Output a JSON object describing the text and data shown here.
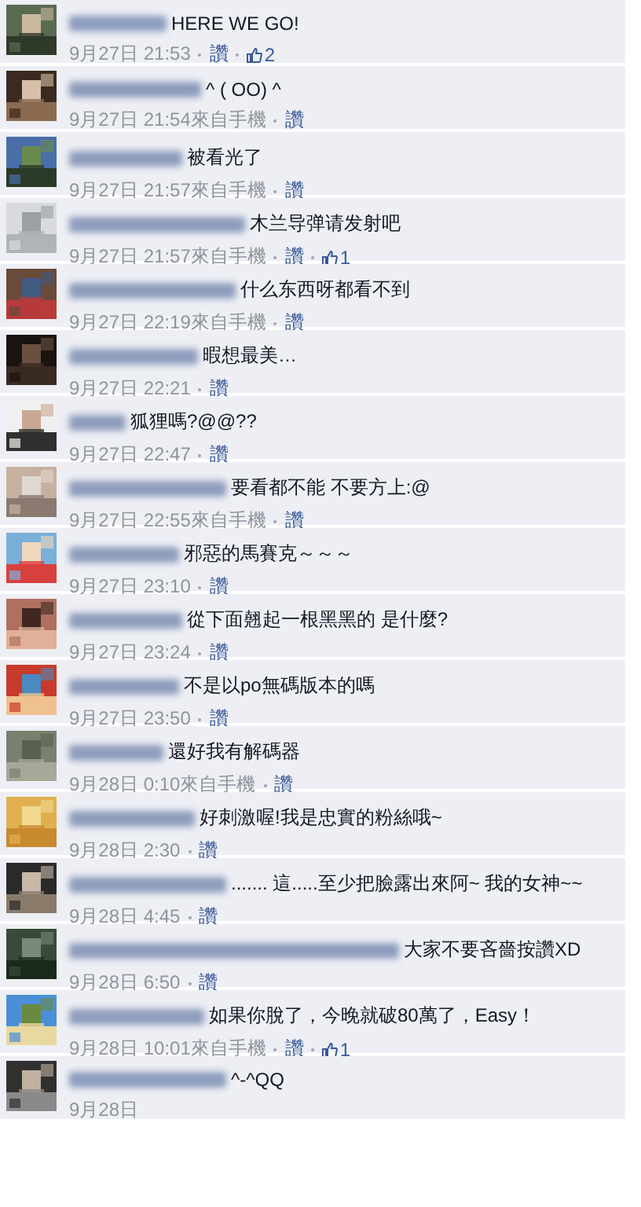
{
  "comments": [
    {
      "text": "HERE WE GO!",
      "time": "9月27日 21:53",
      "like_label": "讚",
      "likes": "2"
    },
    {
      "text": "^ ( OO) ^",
      "time": "9月27日 21:54",
      "source": "來自手機",
      "like_label": "讚"
    },
    {
      "text": "被看光了",
      "time": "9月27日 21:57",
      "source": "來自手機",
      "like_label": "讚"
    },
    {
      "text": "木兰导弹请发射吧",
      "time": "9月27日 21:57",
      "source": "來自手機",
      "like_label": "讚",
      "likes": "1"
    },
    {
      "text": "什么东西呀都看不到",
      "time": "9月27日 22:19",
      "source": "來自手機",
      "like_label": "讚"
    },
    {
      "text": "暇想最美…",
      "time": "9月27日 22:21",
      "like_label": "讚"
    },
    {
      "text": "狐狸嗎?@@??",
      "time": "9月27日 22:47",
      "like_label": "讚"
    },
    {
      "text": "要看都不能 不要方上:@",
      "time": "9月27日 22:55",
      "source": "來自手機",
      "like_label": "讚"
    },
    {
      "text": "邪惡的馬賽克～～～",
      "time": "9月27日 23:10",
      "like_label": "讚"
    },
    {
      "text": "從下面翹起一根黑黑的 是什麼?",
      "time": "9月27日 23:24",
      "like_label": "讚"
    },
    {
      "text": "不是以po無碼版本的嗎",
      "time": "9月27日 23:50",
      "like_label": "讚"
    },
    {
      "text": "還好我有解碼器",
      "time": "9月28日 0:10",
      "source": "來自手機",
      "like_label": "讚"
    },
    {
      "text": "好刺激喔!我是忠實的粉絲哦~",
      "time": "9月28日 2:30",
      "like_label": "讚"
    },
    {
      "text": "....... 這.....至少把臉露出來阿~ 我的女神~~",
      "time": "9月28日 4:45",
      "like_label": "讚"
    },
    {
      "text": "大家不要吝嗇按讚XD",
      "time": "9月28日 6:50",
      "like_label": "讚"
    },
    {
      "text": "如果你脫了，今晚就破80萬了，Easy！",
      "time": "9月28日 10:01",
      "source": "來自手機",
      "like_label": "讚",
      "likes": "1"
    },
    {
      "text": "^-^QQ",
      "time": "9月28日"
    }
  ]
}
